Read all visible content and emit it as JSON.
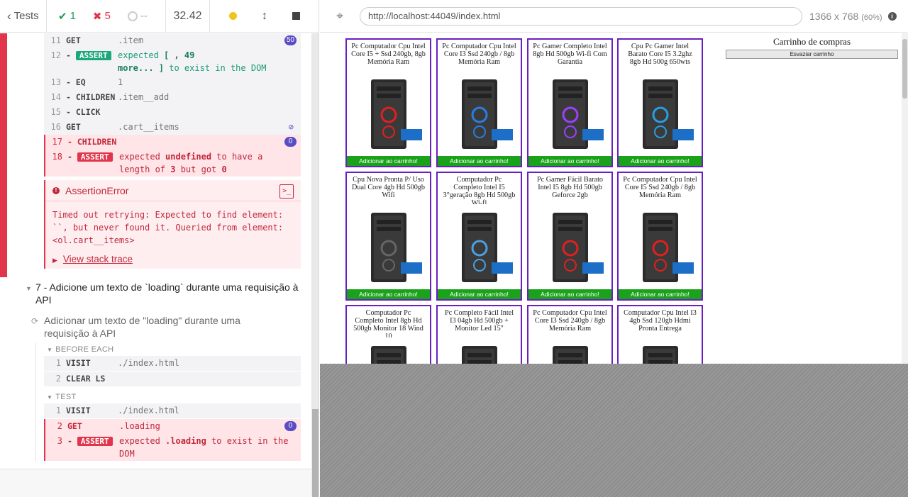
{
  "header": {
    "tests_label": "Tests",
    "passed": "1",
    "failed": "5",
    "pending": "--",
    "duration": "32.42"
  },
  "commands_a": [
    {
      "num": "11",
      "name": "GET",
      "msg": ".item",
      "badge": "50"
    },
    {
      "num": "12",
      "name": "ASSERT",
      "line1": "expected  [ <section.item>, 49",
      "line2": "more... ]  to exist in the DOM"
    },
    {
      "num": "13",
      "name": "EQ",
      "msg": "1"
    },
    {
      "num": "14",
      "name": "CHILDREN",
      "msg": ".item__add"
    },
    {
      "num": "15",
      "name": "CLICK",
      "msg": ""
    },
    {
      "num": "16",
      "name": "GET",
      "msg": ".cart__items"
    },
    {
      "num": "17",
      "name": "CHILDREN",
      "msg": "",
      "badge": "0"
    },
    {
      "num": "18",
      "name": "ASSERT",
      "line1": "expected  undefined  to have a",
      "line2": "length of  3  but got  0"
    }
  ],
  "error": {
    "title": "AssertionError",
    "line1": "Timed out retrying: Expected to find element:",
    "line2": "``, but never found it. Queried from element:",
    "line3": "<ol.cart__items>",
    "stack": "View stack trace"
  },
  "suite": {
    "title": "7 - Adicione um texto de `loading` durante uma requisição à API",
    "test": "Adicionar um texto de \"loading\" durante uma requisição à API",
    "before_each": "BEFORE EACH",
    "test_label": "TEST"
  },
  "commands_b": [
    {
      "num": "1",
      "name": "VISIT",
      "msg": "./index.html"
    },
    {
      "num": "2",
      "name": "CLEAR LS",
      "msg": ""
    }
  ],
  "commands_c": [
    {
      "num": "1",
      "name": "VISIT",
      "msg": "./index.html"
    },
    {
      "num": "2",
      "name": "GET",
      "msg": ".loading",
      "badge": "0"
    },
    {
      "num": "3",
      "name": "ASSERT",
      "line1": "expected  .loading  to exist in the",
      "line2": "DOM"
    }
  ],
  "aut": {
    "url": "http://localhost:44049/index.html",
    "viewport": "1366 x 768",
    "scale": "(60%)"
  },
  "products": [
    {
      "title": "Pc Computador Cpu Intel Core I5 + Ssd 240gb, 8gb Memória Ram"
    },
    {
      "title": "Pc Computador Cpu Intel Core I3 Ssd 240gb / 8gb Memória Ram"
    },
    {
      "title": "Pc Gamer Completo Intel 8gb Hd 500gb Wi-fi Com Garantia"
    },
    {
      "title": "Cpu Pc Gamer Intel Barato Core I5 3.2ghz 8gb Hd 500g 650wts"
    },
    {
      "title": "Cpu Nova Pronta P/ Uso Dual Core 4gb Hd 500gb Wifi"
    },
    {
      "title": "Computador Pc Completo Intel I5 3°geração 8gb Hd 500gb Wi-fi"
    },
    {
      "title": "Pc Gamer Fácil Barato Intel I5 8gb Hd 500gb Geforce 2gb"
    },
    {
      "title": "Pc Computador Cpu Intel Core I5 Ssd 240gb / 8gb Memória Ram"
    },
    {
      "title": "Computador Pc Completo Intel 8gb Hd 500gb Monitor 18 Wind 10"
    },
    {
      "title": "Pc Completo Fácil Intel I3 04gb Hd 500gb + Monitor Led 15\""
    },
    {
      "title": "Pc Computador Cpu Intel Core I3 Ssd 240gb / 8gb Memória Ram"
    },
    {
      "title": "Computador Cpu Intel I3 4gb Ssd 120gb Hdmi Pronta Entrega"
    }
  ],
  "add_label": "Adicionar ao carrinho!",
  "cart": {
    "title": "Carrinho de compras",
    "empty_label": "Esvaziar carrinho"
  }
}
